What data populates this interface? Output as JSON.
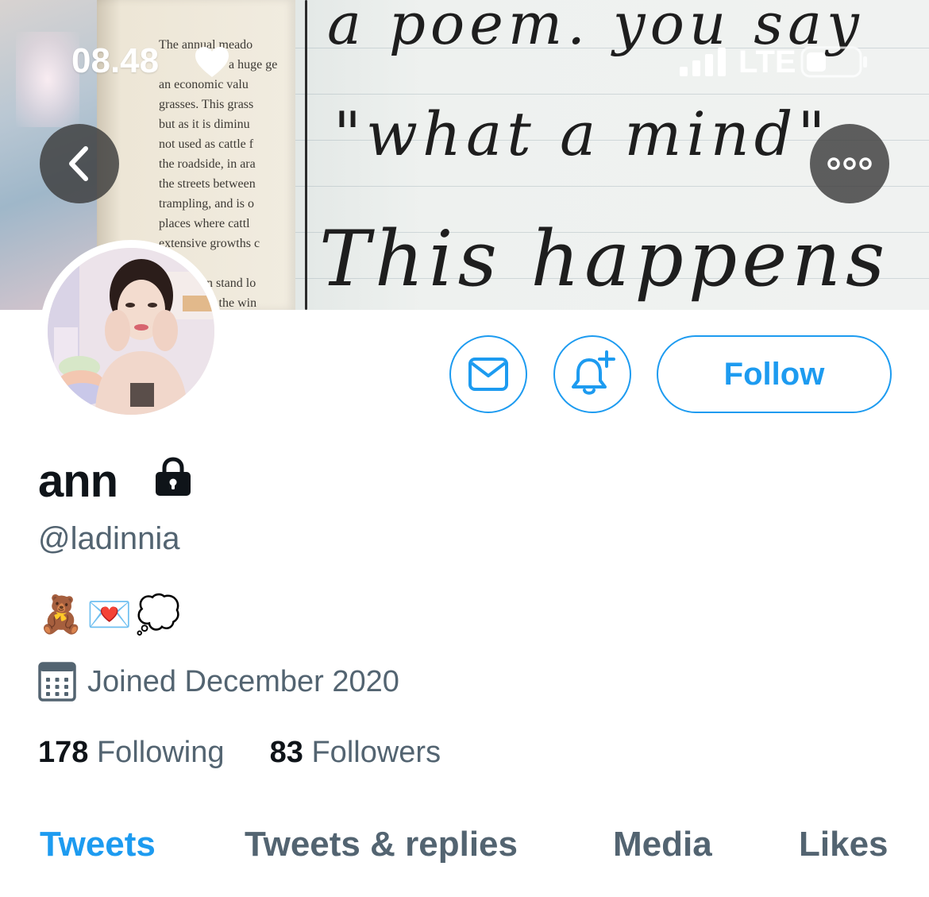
{
  "status_bar": {
    "time": "08.48",
    "network": "LTE",
    "heart_icon": "heart-icon",
    "signal_icon": "signal-bars-icon",
    "battery_icon": "battery-icon"
  },
  "banner": {
    "book_lines": [
      "The annual meado",
      "a huge ge",
      "an economic valu",
      "grasses. This grass",
      "but as it is diminu",
      "not used as cattle f",
      "the roadside, in ara",
      "the streets between",
      "trampling, and is o",
      "places where cattl",
      "extensive growths c",
      "",
      "n stand lo",
      "at the win"
    ],
    "handwriting": [
      "a poem. you say",
      "\"what a mind\"",
      "This happens"
    ]
  },
  "header": {
    "back_icon": "chevron-left-icon",
    "more_icon": "more-horizontal-icon"
  },
  "actions": {
    "message_icon": "mail-icon",
    "notify_icon": "bell-plus-icon",
    "follow_label": "Follow"
  },
  "profile": {
    "display_name": "ann",
    "protected_icon": "lock-icon",
    "handle": "@ladinnia",
    "bio": "🧸💌💭",
    "joined": "Joined December 2020",
    "following_count": "178",
    "following_label": "Following",
    "followers_count": "83",
    "followers_label": "Followers"
  },
  "tabs": [
    {
      "label": "Tweets",
      "active": true
    },
    {
      "label": "Tweets & replies",
      "active": false
    },
    {
      "label": "Media",
      "active": false
    },
    {
      "label": "Likes",
      "active": false
    }
  ],
  "colors": {
    "accent": "#1d9bf0",
    "text_primary": "#0f1419",
    "text_secondary": "#536471"
  }
}
